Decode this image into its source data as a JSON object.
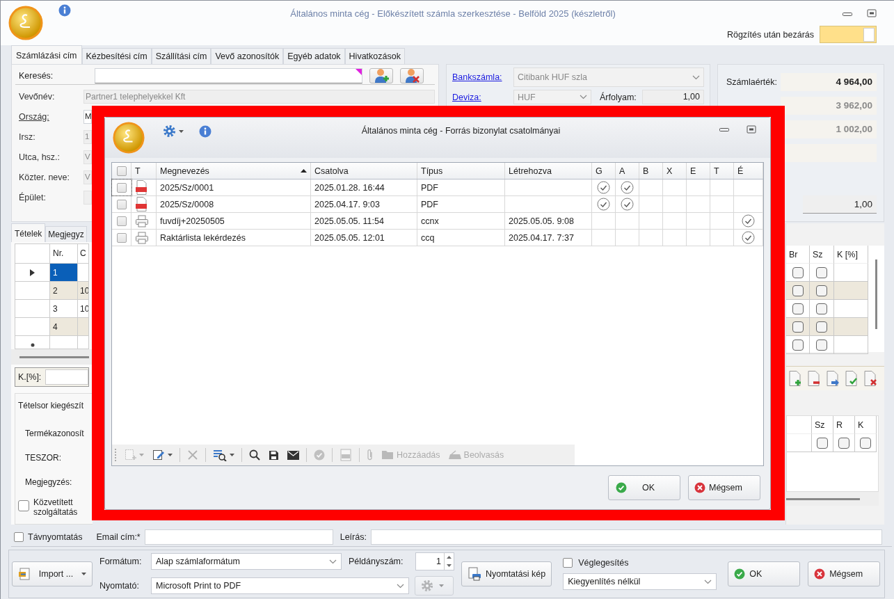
{
  "window": {
    "title": "Általános minta cég - Előkészített számla szerkesztése - Belföld 2025 (készletről)"
  },
  "close_after_save": {
    "label": "Rögzítés után bezárás",
    "on": true
  },
  "address_tabs": [
    {
      "label": "Számlázási cím",
      "selected": true
    },
    {
      "label": "Kézbesítési cím",
      "selected": false
    },
    {
      "label": "Szállítási cím",
      "selected": false
    },
    {
      "label": "Vevő azonosítók",
      "selected": false
    },
    {
      "label": "Egyéb adatok",
      "selected": false
    },
    {
      "label": "Hivatkozások",
      "selected": false
    }
  ],
  "search": {
    "label": "Keresés:"
  },
  "address_fields": [
    {
      "label": "Vevőnév:",
      "value": "Partner1 telephelyekkel Kft",
      "link": false,
      "disabled": true
    },
    {
      "label": "Ország:",
      "value": "M",
      "link": true,
      "disabled": false
    },
    {
      "label": "Irsz:",
      "value": "1",
      "link": false,
      "disabled": true
    },
    {
      "label": "Utca, hsz.:",
      "value": "V",
      "link": false,
      "disabled": true
    },
    {
      "label": "Közter. neve:",
      "value": "V",
      "link": false,
      "disabled": true
    },
    {
      "label": "Épület:",
      "link": false,
      "disabled": true
    }
  ],
  "bank": {
    "label": "Bankszámla:",
    "value": "Citibank HUF szla"
  },
  "currency": {
    "label": "Deviza:",
    "value": "HUF",
    "rate_label": "Árfolyam:",
    "rate": "1,00"
  },
  "totals": [
    {
      "label": "Számlaérték:",
      "value": "4 964,00",
      "disabled": false
    },
    {
      "value": "3 962,00",
      "disabled": true
    },
    {
      "value": "1 002,00",
      "disabled": true
    }
  ],
  "rate_total": "1,00",
  "items_tabs": [
    {
      "label": "Tételek",
      "selected": true
    },
    {
      "label": "Megjegyz",
      "selected": false
    }
  ],
  "items_grid": {
    "left_columns": [
      "Nr.",
      "C"
    ],
    "right_columns": [
      "Br",
      "Sz",
      "K [%]"
    ],
    "rows": [
      {
        "cells": [
          "1"
        ],
        "selected": true,
        "br": false,
        "sz": false
      },
      {
        "cells": [
          "2",
          "10"
        ],
        "selected": false,
        "br": false,
        "sz": false
      },
      {
        "cells": [
          "3",
          "10"
        ],
        "selected": false,
        "br": false,
        "sz": false
      },
      {
        "cells": [
          "4"
        ],
        "selected": false,
        "br": false,
        "sz": false
      }
    ],
    "new_row": {
      "br": false,
      "sz": false
    }
  },
  "discount": {
    "label": "K.[%]:"
  },
  "line_details": {
    "title": "Tételsor kiegészít",
    "labels": [
      "Termékazonosít",
      "TESZOR:",
      "Megjegyzés:"
    ],
    "intermediated": {
      "label": "Közvetített szolgáltatás",
      "checked": false
    },
    "grid": {
      "columns": [
        "Sz",
        "R",
        "K"
      ],
      "rows": [
        {
          "flags": [
            false,
            false,
            false
          ]
        }
      ]
    }
  },
  "dialog": {
    "title": "Általános minta cég - Forrás bizonylat csatolmányai",
    "all_checked": false,
    "columns": [
      {
        "label": "T",
        "sort_ascending": false
      },
      {
        "label": "Megnevezés",
        "sort_ascending": true
      },
      {
        "label": "Csatolva",
        "sort_ascending": false
      },
      {
        "label": "Típus",
        "sort_ascending": false
      },
      {
        "label": "Létrehozva",
        "sort_ascending": false
      },
      {
        "label": "G",
        "sort_ascending": false
      },
      {
        "label": "A",
        "sort_ascending": false
      },
      {
        "label": "B",
        "sort_ascending": false
      },
      {
        "label": "X",
        "sort_ascending": false
      },
      {
        "label": "E",
        "sort_ascending": false
      },
      {
        "label": "T",
        "sort_ascending": false
      },
      {
        "label": "É",
        "sort_ascending": false
      }
    ],
    "rows": [
      {
        "checked": false,
        "kind": "pdf",
        "name": "2025/Sz/0001",
        "attached": "2025.01.28. 16:44",
        "type": "PDF",
        "flags": [
          true,
          true,
          false,
          false,
          false,
          false,
          false
        ]
      },
      {
        "checked": false,
        "kind": "pdf",
        "name": "2025/Sz/0008",
        "attached": "2025.04.17. 9:03",
        "type": "PDF",
        "flags": [
          true,
          true,
          false,
          false,
          false,
          false,
          false
        ]
      },
      {
        "checked": false,
        "kind": "report",
        "name": "fuvdíj+20250505",
        "attached": "2025.05.05. 11:54",
        "type": "ccnx",
        "created": "2025.05.05. 9:08",
        "flags": [
          false,
          false,
          false,
          false,
          false,
          false,
          true
        ]
      },
      {
        "checked": false,
        "kind": "report",
        "name": "Raktárlista lekérdezés",
        "attached": "2025.05.05. 12:01",
        "type": "ccq",
        "created": "2025.04.17. 7:37",
        "flags": [
          false,
          false,
          false,
          false,
          false,
          false,
          true
        ]
      }
    ],
    "toolbar": [
      {
        "disabled": true
      },
      {
        "disabled": false
      },
      {
        "disabled": true
      },
      {
        "disabled": false
      },
      {
        "disabled": false
      },
      {
        "disabled": false
      },
      {
        "disabled": false
      },
      {
        "disabled": true
      },
      {
        "disabled": true
      },
      {
        "disabled": true
      },
      {
        "label": "Hozzáadás",
        "disabled": true
      },
      {
        "label": "Beolvasás",
        "disabled": true
      }
    ],
    "ok": "OK",
    "cancel": "Mégsem"
  },
  "bottom": {
    "remote_print": {
      "label": "Távnyomtatás",
      "checked": false
    },
    "email": {
      "label": "Email cím:*"
    },
    "description": {
      "label": "Leírás:"
    },
    "import_button": "Import ...",
    "format": {
      "label": "Formátum:",
      "value": "Alap számlaformátum"
    },
    "printer": {
      "label": "Nyomtató:",
      "value": "Microsoft Print to PDF"
    },
    "copies": {
      "label": "Példányszám:",
      "value": "1"
    },
    "preview_button": "Nyomtatási kép",
    "finalize": {
      "label": "Véglegesítés",
      "checked": false
    },
    "settlement": {
      "value": "Kiegyenlítés nélkül"
    },
    "ok": "OK",
    "cancel": "Mégsem"
  }
}
